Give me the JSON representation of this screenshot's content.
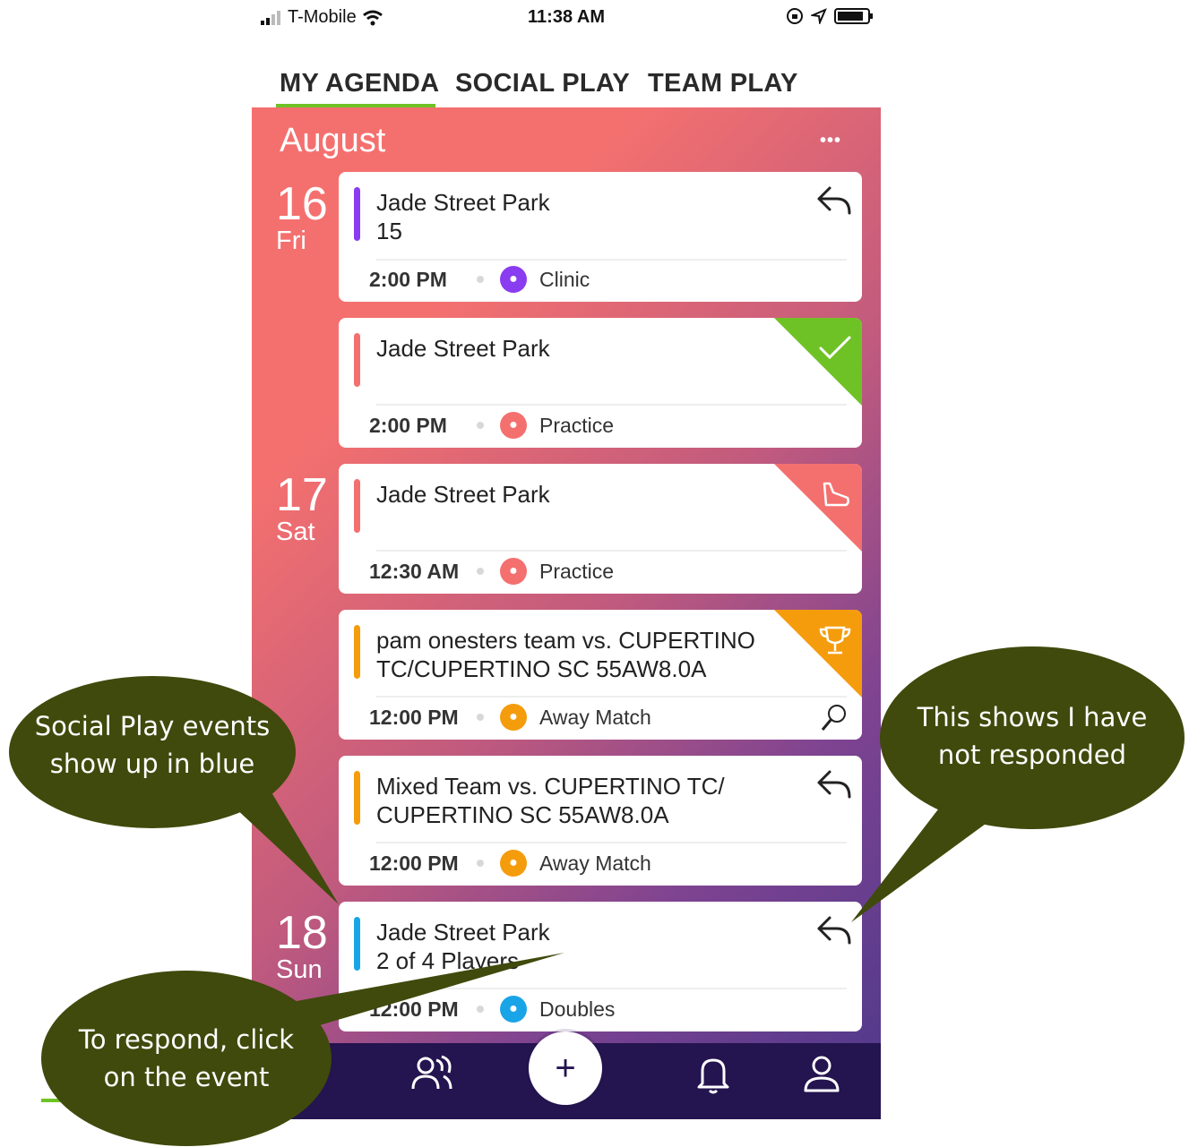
{
  "status_bar": {
    "carrier": "T-Mobile",
    "time": "11:38 AM"
  },
  "tabs": [
    {
      "label": "MY AGENDA",
      "active": true
    },
    {
      "label": "SOCIAL PLAY",
      "active": false
    },
    {
      "label": "TEAM PLAY",
      "active": false
    }
  ],
  "agenda": {
    "month": "August",
    "more": "•••",
    "days": [
      {
        "num": "16",
        "dow": "Fri"
      },
      {
        "num": "17",
        "dow": "Sat"
      },
      {
        "num": "18",
        "dow": "Sun"
      }
    ],
    "events": [
      {
        "title": "Jade Street Park",
        "subtitle": "15",
        "time": "2:00 PM",
        "type": "Clinic",
        "bar_color": "#8a3cf0",
        "icon": "racquet-icon",
        "status": "not-responded"
      },
      {
        "title": "Jade Street Park",
        "subtitle": "",
        "time": "2:00 PM",
        "type": "Practice",
        "bar_color": "#f4706f",
        "icon": "shoe-icon",
        "status": "accepted"
      },
      {
        "title": "Jade Street Park",
        "subtitle": "",
        "time": "12:30 AM",
        "type": "Practice",
        "bar_color": "#f4706f",
        "icon": "shoe-icon",
        "status": "practice-corner"
      },
      {
        "title": "pam onesters team vs. CUPERTINO TC/CUPERTINO SC 55AW8.0A",
        "subtitle": "",
        "time": "12:00 PM",
        "type": "Away Match",
        "bar_color": "#f59c0d",
        "icon": "trophy-icon",
        "status": "match-corner"
      },
      {
        "title": "Mixed Team vs. CUPERTINO TC/ CUPERTINO SC 55AW8.0A",
        "subtitle": "",
        "time": "12:00 PM",
        "type": "Away Match",
        "bar_color": "#f59c0d",
        "icon": "trophy-icon",
        "status": "not-responded"
      },
      {
        "title": "Jade Street Park",
        "subtitle": "2 of 4 Players",
        "time": "12:00 PM",
        "type": "Doubles",
        "bar_color": "#1aa4e8",
        "icon": "players-icon",
        "status": "not-responded"
      }
    ]
  },
  "annotations": {
    "social_play": "Social Play events show up in blue",
    "not_responded": "This shows I have not responded",
    "respond": "To respond, click on the event"
  },
  "colors": {
    "accent_green": "#6fc226",
    "nav_bg": "#24144f",
    "bubble": "#3f4a0c"
  }
}
